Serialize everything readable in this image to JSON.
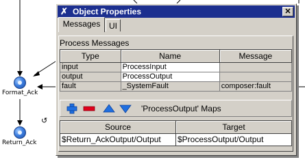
{
  "dialog": {
    "title": "Object Properties",
    "close_glyph": "✕",
    "tabs": [
      {
        "label": "Messages",
        "active": true
      },
      {
        "label": "UI",
        "active": false
      }
    ]
  },
  "process_messages": {
    "label": "Process Messages",
    "columns": [
      "Type",
      "Name",
      "Message"
    ],
    "rows": [
      {
        "type": "input",
        "name": "ProcessInput",
        "message": ""
      },
      {
        "type": "output",
        "name": "ProcessOutput",
        "message": ""
      },
      {
        "type": "fault",
        "name": "_SystemFault",
        "message": "composer:fault"
      }
    ]
  },
  "maps": {
    "label": "'ProcessOutput' Maps",
    "columns": [
      "Source",
      "Target"
    ],
    "rows": [
      {
        "source": "$Return_AckOutput/Output",
        "target": "$ProcessOutput/Output"
      }
    ]
  },
  "toolbar": {
    "buttons": [
      {
        "icon": "add-icon",
        "color": "#1f6fe0"
      },
      {
        "icon": "remove-icon",
        "color": "#e0001c"
      },
      {
        "icon": "move-up-icon",
        "color": "#1f6fe0"
      },
      {
        "icon": "move-down-icon",
        "color": "#1f6fe0"
      }
    ]
  },
  "canvas": {
    "nodes": [
      {
        "label": "Format_Ack"
      },
      {
        "label": "Return_Ack"
      }
    ]
  },
  "colors": {
    "titlebar": "#1c2f8f",
    "dialog_bg": "#d4d0c8"
  }
}
